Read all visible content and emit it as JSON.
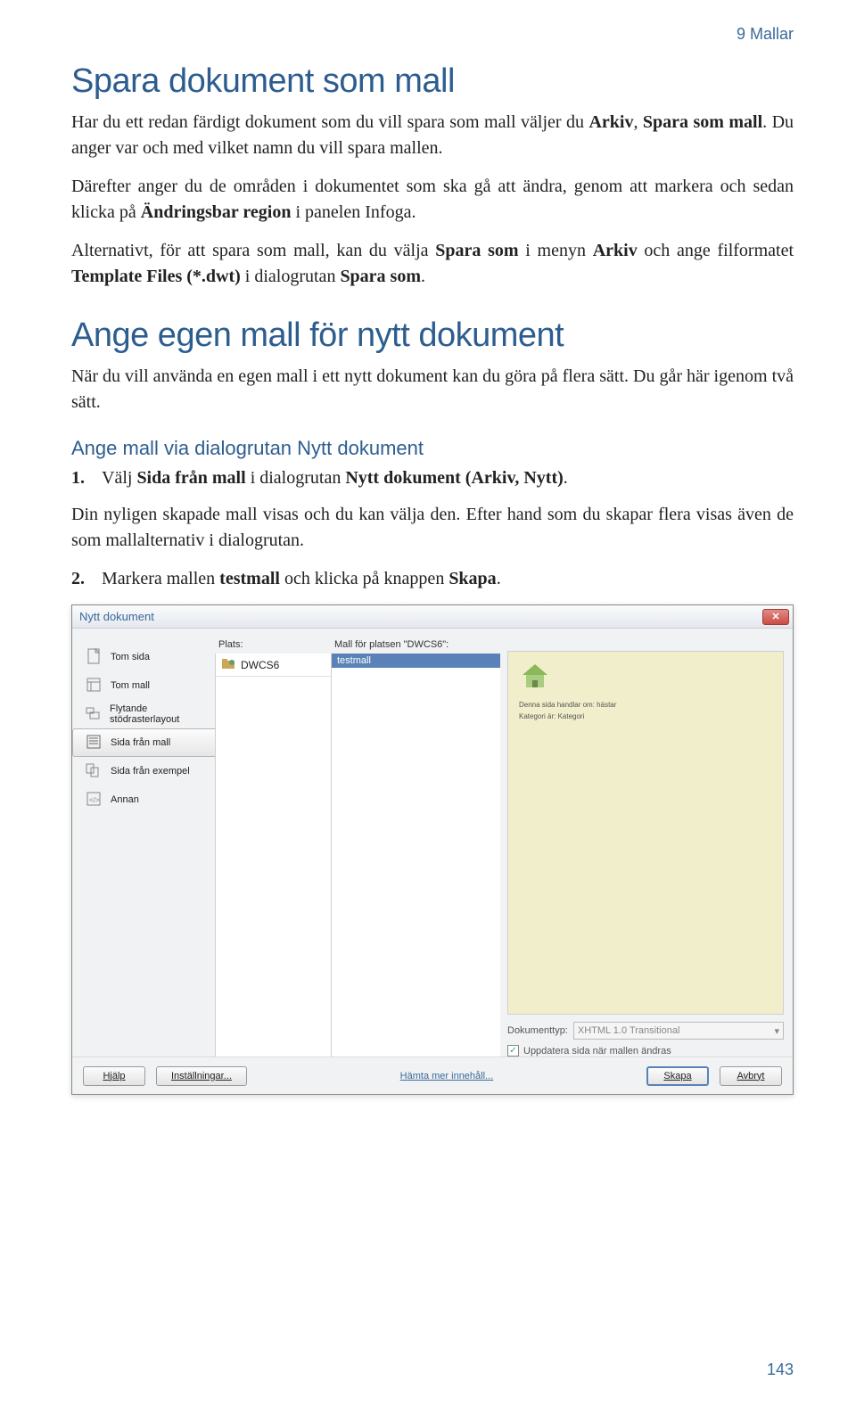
{
  "header": {
    "chapter": "9 Mallar"
  },
  "section1": {
    "title": "Spara dokument som mall",
    "p1_a": "Har du ett redan färdigt dokument som du vill spara som mall väljer du ",
    "p1_b": "Arkiv",
    "p1_c": ", ",
    "p1_d": "Spara som mall",
    "p1_e": ". Du anger var och med vilket namn du vill spara mallen.",
    "p2_a": "Därefter anger du de områden i dokumentet som ska gå att ändra, genom att markera och sedan klicka på ",
    "p2_b": "Ändringsbar region",
    "p2_c": " i panelen Infoga.",
    "p3_a": "Alternativt, för att spara som mall, kan du välja ",
    "p3_b": "Spara som",
    "p3_c": " i menyn ",
    "p3_d": "Arkiv",
    "p3_e": " och ange filformatet ",
    "p3_f": "Template Files (*.dwt)",
    "p3_g": " i dialogrutan ",
    "p3_h": "Spara som",
    "p3_i": "."
  },
  "section2": {
    "title": "Ange egen mall för nytt dokument",
    "p1": "När du vill använda en egen mall i ett nytt dokument kan du göra på flera sätt. Du går här igenom två sätt.",
    "sub": "Ange mall via dialogrutan Nytt dokument",
    "step1_a": "Välj ",
    "step1_b": "Sida från mall",
    "step1_c": " i dialogrutan ",
    "step1_d": "Nytt dokument (Arkiv, Nytt)",
    "step1_e": ".",
    "p2": "Din nyligen skapade mall visas och du kan välja den. Efter hand som du skapar flera visas även de som mallalternativ i dialogrutan.",
    "step2_a": "Markera mallen ",
    "step2_b": "testmall",
    "step2_c": " och klicka på knappen ",
    "step2_d": "Skapa",
    "step2_e": "."
  },
  "dialog": {
    "title": "Nytt dokument",
    "close": "✕",
    "labels": {
      "plats": "Plats:",
      "mall": "Mall för platsen \"DWCS6\":"
    },
    "sidebar": [
      {
        "label": "Tom sida"
      },
      {
        "label": "Tom mall"
      },
      {
        "label": "Flytande stödrasterlayout"
      },
      {
        "label": "Sida från mall"
      },
      {
        "label": "Sida från exempel"
      },
      {
        "label": "Annan"
      }
    ],
    "site": "DWCS6",
    "template": "testmall",
    "preview": {
      "line1": "Denna sida handlar om: hästar",
      "line2": "Kategori är: Kategori"
    },
    "doctype": {
      "label": "Dokumenttyp:",
      "value": "XHTML 1.0 Transitional"
    },
    "update": "Uppdatera sida när mallen ändras",
    "footer": {
      "help": "Hjälp",
      "settings": "Inställningar...",
      "more": "Hämta mer innehåll...",
      "create": "Skapa",
      "cancel": "Avbryt"
    }
  },
  "page": "143"
}
